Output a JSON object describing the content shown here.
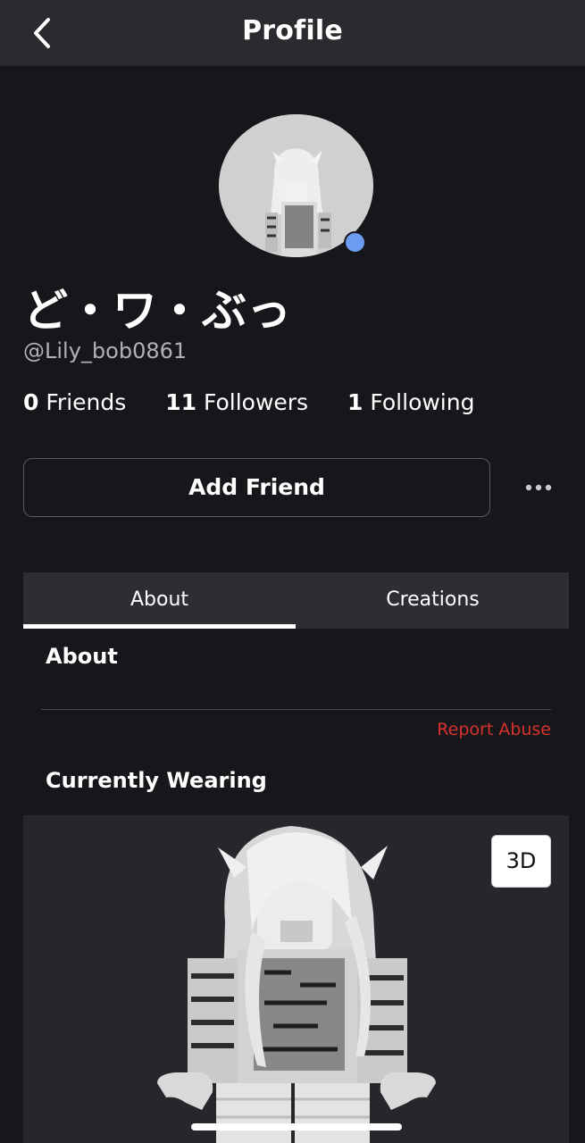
{
  "header": {
    "title": "Profile"
  },
  "profile": {
    "display_name": "ど・ワ・ぶっ",
    "username": "@Lily_bob0861",
    "online_status_color": "#6c9cf2"
  },
  "stats": {
    "friends_count": "0",
    "friends_label": "Friends",
    "followers_count": "11",
    "followers_label": "Followers",
    "following_count": "1",
    "following_label": "Following"
  },
  "actions": {
    "add_friend_label": "Add Friend",
    "more_icon": "more-horizontal-icon"
  },
  "tabs": [
    {
      "label": "About",
      "active": true
    },
    {
      "label": "Creations",
      "active": false
    }
  ],
  "about": {
    "heading": "About",
    "report_abuse_label": "Report Abuse",
    "report_abuse_color": "#d9322c"
  },
  "wearing": {
    "heading": "Currently Wearing",
    "view_3d_label": "3D"
  }
}
